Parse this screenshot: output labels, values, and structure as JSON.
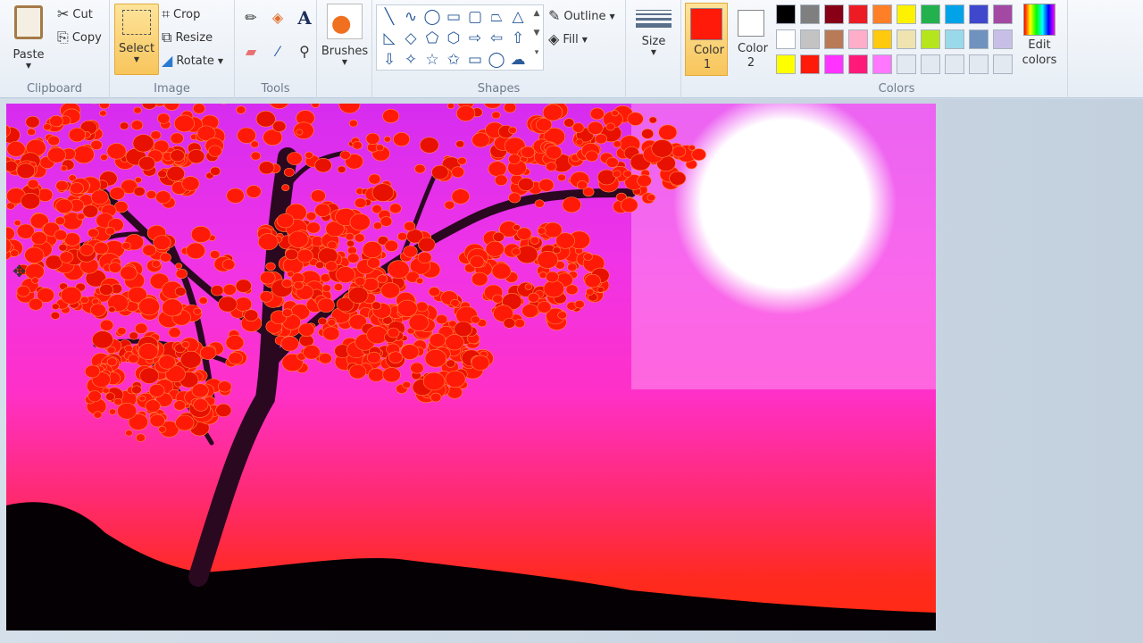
{
  "clipboard": {
    "paste": "Paste",
    "cut": "Cut",
    "copy": "Copy",
    "label": "Clipboard"
  },
  "image": {
    "select": "Select",
    "crop": "Crop",
    "resize": "Resize",
    "rotate": "Rotate",
    "label": "Image"
  },
  "tools": {
    "label": "Tools",
    "items": [
      "pencil-icon",
      "fill-icon",
      "text-icon",
      "eraser-icon",
      "color-picker-icon",
      "magnifier-icon"
    ]
  },
  "brushes": {
    "label": "Brushes"
  },
  "shapes": {
    "label": "Shapes",
    "outline": "Outline",
    "fill": "Fill",
    "glyphs": [
      "╲",
      "∿",
      "◯",
      "▭",
      "▢",
      "⏢",
      "△",
      "◺",
      "◇",
      "⬠",
      "⬡",
      "⇨",
      "⇦",
      "⇧",
      "⇩",
      "✧",
      "☆",
      "✩",
      "▭",
      "◯",
      "☁"
    ]
  },
  "size": {
    "label": "Size"
  },
  "color1": {
    "label": "Color 1",
    "value": "#ff1a0a"
  },
  "color2": {
    "label": "Color 2",
    "value": "#ffffff"
  },
  "colors": {
    "label": "Colors",
    "edit": "Edit colors",
    "palette": [
      "#000000",
      "#7f7f7f",
      "#880015",
      "#ed1c24",
      "#ff7f27",
      "#fff200",
      "#22b14c",
      "#00a2e8",
      "#3f48cc",
      "#a349a4",
      "#ffffff",
      "#c3c3c3",
      "#b97a57",
      "#ffaec9",
      "#ffc90e",
      "#efe4b0",
      "#b5e61d",
      "#99d9ea",
      "#7092be",
      "#c8bfe7",
      "#ffff00",
      "#ff1a0a",
      "#ff33ff",
      "#ff1a7a",
      "#ff77ff",
      "#e3e9f1",
      "#e3e9f1",
      "#e3e9f1",
      "#e3e9f1",
      "#e3e9f1"
    ]
  }
}
